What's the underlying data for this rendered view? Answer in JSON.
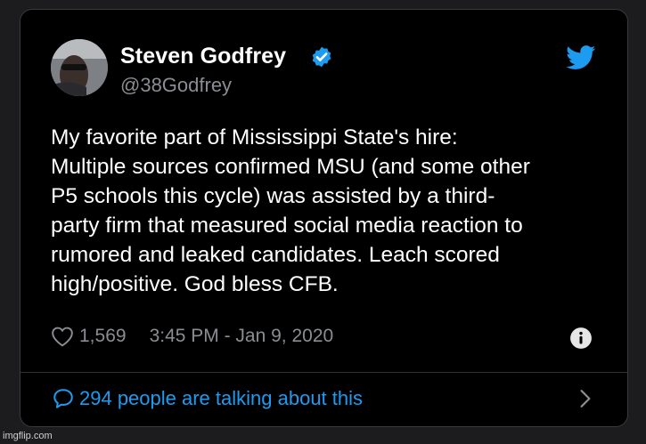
{
  "tweet": {
    "author_name": "Steven Godfrey",
    "handle": "@38Godfrey",
    "lines": [
      "My favorite part of Mississippi State's hire:",
      "Multiple sources confirmed MSU (and some other",
      "P5 schools this cycle) was assisted by a third-",
      "party firm that measured social media reaction to",
      "rumored and leaked candidates. Leach scored",
      "high/positive. God bless CFB."
    ],
    "likes": "1,569",
    "timestamp": "3:45 PM - Jan 9, 2020",
    "talking": "294 people are talking about this"
  },
  "colors": {
    "background": "#000000",
    "accent": "#1d9bf0",
    "secondary_text": "#8a8d91"
  },
  "icons": [
    "verified-badge-icon",
    "twitter-bird-icon",
    "heart-icon",
    "info-icon",
    "chat-bubble-icon",
    "chevron-right-icon"
  ],
  "watermark": "imgflip.com"
}
